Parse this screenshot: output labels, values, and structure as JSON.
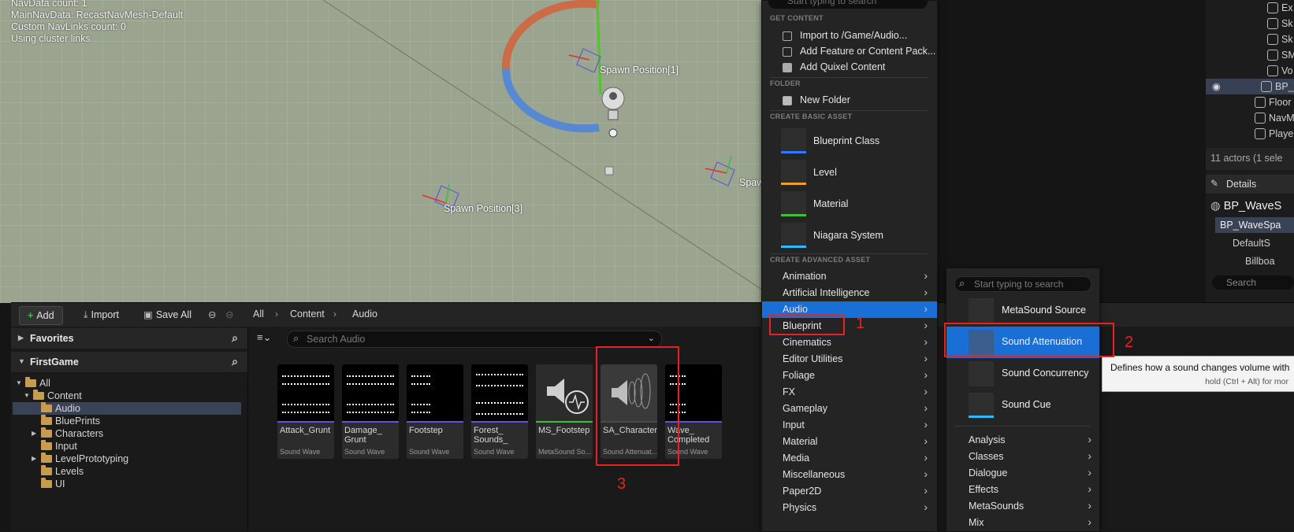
{
  "viewport": {
    "stats": [
      "NavData count: 1",
      "MainNavData: RecastNavMesh-Default",
      "Custom NavLinks count: 0",
      "Using cluster links"
    ],
    "spawn_labels": [
      "Spawn Position[1]",
      "Spawn Position[3]",
      "Spaw"
    ]
  },
  "outliner": {
    "rows": [
      "Ex",
      "Sk",
      "Sk",
      "SM",
      "Vo",
      "BP_W",
      "Floor",
      "NavM",
      "Playe"
    ],
    "actors_count": "11 actors (1 sele",
    "details_title": "Details",
    "bp_title": "BP_WaveS",
    "bp_component": "BP_WaveSpa",
    "default_scene": "DefaultS",
    "billboard": "Billboa",
    "search": "Search"
  },
  "content_browser": {
    "toolbar": {
      "add": "Add",
      "import": "Import",
      "save_all": "Save All"
    },
    "breadcrumb": [
      "All",
      "Content",
      "Audio"
    ],
    "sections": {
      "favorites": "Favorites",
      "project": "FirstGame"
    },
    "tree": [
      "All",
      "Content",
      "Audio",
      "BluePrints",
      "Characters",
      "Input",
      "LevelPrototyping",
      "Levels",
      "UI"
    ],
    "search_placeholder": "Search Audio",
    "assets": [
      {
        "name": "Attack_Grunt",
        "type": "Sound Wave"
      },
      {
        "name": "Damage_ Grunt",
        "type": "Sound Wave"
      },
      {
        "name": "Footstep",
        "type": "Sound Wave"
      },
      {
        "name": "Forest_ Sounds_",
        "type": "Sound Wave"
      },
      {
        "name": "MS_Footstep",
        "type": "MetaSound So..."
      },
      {
        "name": "SA_Character",
        "type": "Sound Attenuat..."
      },
      {
        "name": "Wave_ Completed",
        "type": "Sound Wave"
      }
    ]
  },
  "context_menu": {
    "search_placeholder": "Start typing to search",
    "sections": {
      "get_content": "GET CONTENT",
      "folder": "FOLDER",
      "create_basic": "CREATE BASIC ASSET",
      "create_advanced": "CREATE ADVANCED ASSET"
    },
    "get_content_items": [
      "Import to /Game/Audio...",
      "Add Feature or Content Pack...",
      "Add Quixel Content"
    ],
    "folder_item": "New Folder",
    "basic_assets": [
      {
        "name": "Blueprint Class",
        "color": "#2f7bff"
      },
      {
        "name": "Level",
        "color": "#f0a020"
      },
      {
        "name": "Material",
        "color": "#3cbf3c"
      },
      {
        "name": "Niagara System",
        "color": "#31b8ff"
      }
    ],
    "advanced_categories": [
      "Animation",
      "Artificial Intelligence",
      "Audio",
      "Blueprint",
      "Cinematics",
      "Editor Utilities",
      "Foliage",
      "FX",
      "Gameplay",
      "Input",
      "Material",
      "Media",
      "Miscellaneous",
      "Paper2D",
      "Physics"
    ]
  },
  "audio_submenu": {
    "search_placeholder": "Start typing to search",
    "items": [
      {
        "name": "MetaSound Source"
      },
      {
        "name": "Sound Attenuation"
      },
      {
        "name": "Sound Concurrency"
      },
      {
        "name": "Sound Cue"
      }
    ],
    "categories": [
      "Analysis",
      "Classes",
      "Dialogue",
      "Effects",
      "MetaSounds",
      "Mix"
    ]
  },
  "tooltip": {
    "text": "Defines how a sound changes volume with",
    "hint": "hold (Ctrl + Alt) for mor"
  },
  "annotations": [
    "1",
    "2",
    "3"
  ],
  "colors": {
    "accent": "#1a6fd6",
    "annotation": "#e8221c",
    "folder": "#c89a52"
  }
}
